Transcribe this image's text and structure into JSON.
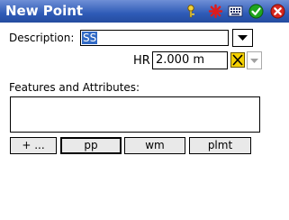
{
  "window": {
    "title": "New Point"
  },
  "title_icons": [
    "help-icon",
    "gps-star-icon",
    "keyboard-icon",
    "ok-icon",
    "close-icon"
  ],
  "description": {
    "label": "Description:",
    "value": "SS"
  },
  "hr": {
    "label": "HR",
    "value": "2.000 m"
  },
  "features": {
    "label": "Features and Attributes:"
  },
  "buttons": [
    {
      "label": "+ ..."
    },
    {
      "label": "pp",
      "selected": true
    },
    {
      "label": "wm"
    },
    {
      "label": "plmt"
    }
  ],
  "colors": {
    "titlebar": "#2f5bb7",
    "selection": "#316ac5",
    "ok": "#1fa51f",
    "close": "#d7261e"
  }
}
